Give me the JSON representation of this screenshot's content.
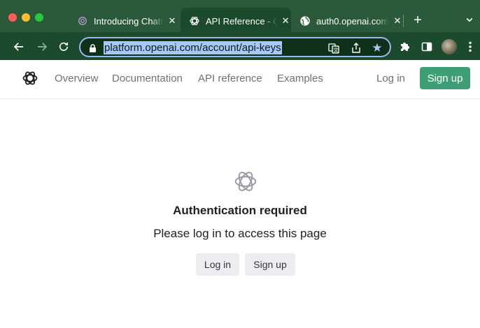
{
  "browser": {
    "tabs": [
      {
        "title": "Introducing ChatG",
        "active": false,
        "favicon": "openai-purple-icon"
      },
      {
        "title": "API Reference - OpenAI",
        "active": true,
        "favicon": "openai-icon"
      },
      {
        "title": "auth0.openai.com",
        "active": false,
        "favicon": "globe-icon"
      }
    ],
    "new_tab_symbol": "+",
    "url": "platform.openai.com/account/api-keys"
  },
  "nav": {
    "items": [
      "Overview",
      "Documentation",
      "API reference",
      "Examples"
    ],
    "login": "Log in",
    "signup": "Sign up"
  },
  "auth": {
    "title": "Authentication required",
    "subtitle": "Please log in to access this page",
    "login_button": "Log in",
    "signup_button": "Sign up"
  },
  "colors": {
    "chrome_tabbar": "#2b5a3b",
    "chrome_toolbar": "#1b4a2c",
    "signup_accent": "#3e9e76",
    "url_highlight": "#a8c7fa"
  }
}
